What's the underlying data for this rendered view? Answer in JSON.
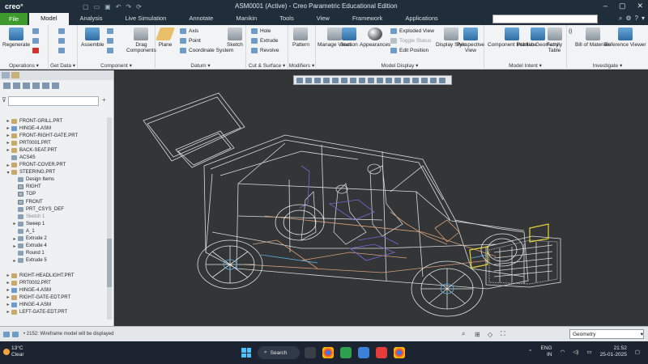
{
  "app": {
    "logo": "creo°",
    "window_title": "ASM0001 (Active) - Creo Parametric Educational Edition"
  },
  "menu_tabs": [
    "File",
    "Model",
    "Analysis",
    "Live Simulation",
    "Annotate",
    "Manikin",
    "Tools",
    "View",
    "Framework",
    "Applications"
  ],
  "active_tab": "Model",
  "ribbon": {
    "regenerate": "Regenerate",
    "assemble": "Assemble",
    "drag_components": "Drag Components",
    "plane": "Plane",
    "axis": "Axis",
    "point": "Point",
    "coord_sys": "Coordinate System",
    "sketch": "Sketch",
    "hole": "Hole",
    "extrude": "Extrude",
    "revolve": "Revolve",
    "pattern": "Pattern",
    "manage_views": "Manage Views",
    "section": "Section",
    "appearances": "Appearances",
    "exploded_view": "Exploded View",
    "toggle_status": "Toggle Status",
    "edit_position": "Edit Position",
    "display_style": "Display Style",
    "perspective_view": "Perspective View",
    "component_interface": "Component Interface",
    "publish_geometry": "Publish Geometry",
    "family_table": "Family Table",
    "bill_of_materials": "Bill of Materials",
    "reference_viewer": "Reference Viewer",
    "groups": {
      "operations": "Operations ▾",
      "get_data": "Get Data ▾",
      "component": "Component ▾",
      "datum": "Datum ▾",
      "cut_surface": "Cut & Surface ▾",
      "modifiers": "Modifiers ▾",
      "model_display": "Model Display ▾",
      "model_intent": "Model Intent ▾",
      "investigate": "Investigate ▾"
    }
  },
  "tree": [
    {
      "label": "FRONT-GRILL.PRT",
      "type": "part",
      "indent": 1,
      "exp": "▸"
    },
    {
      "label": "HINGE-4.ASM",
      "type": "asm",
      "indent": 1,
      "exp": "▸"
    },
    {
      "label": "FRONT-RIGHT-GATE.PRT",
      "type": "part",
      "indent": 1,
      "exp": "▸"
    },
    {
      "label": "PRT0001.PRT",
      "type": "part",
      "indent": 1,
      "exp": "▸"
    },
    {
      "label": "BACK-SEAT.PRT",
      "type": "part",
      "indent": 1,
      "exp": "▸"
    },
    {
      "label": "ACS4S",
      "type": "feat",
      "indent": 1,
      "exp": ""
    },
    {
      "label": "FRONT-COVER.PRT",
      "type": "part",
      "indent": 1,
      "exp": "▸"
    },
    {
      "label": "STEERING.PRT",
      "type": "part",
      "indent": 1,
      "exp": "▾"
    },
    {
      "label": "Design Items",
      "type": "feat",
      "indent": 2,
      "exp": ""
    },
    {
      "label": "RIGHT",
      "type": "plane",
      "indent": 2,
      "exp": ""
    },
    {
      "label": "TOP",
      "type": "plane",
      "indent": 2,
      "exp": ""
    },
    {
      "label": "FRONT",
      "type": "plane",
      "indent": 2,
      "exp": ""
    },
    {
      "label": "PRT_CSYS_DEF",
      "type": "feat",
      "indent": 2,
      "exp": ""
    },
    {
      "label": "Sketch 1",
      "type": "feat",
      "indent": 2,
      "exp": "",
      "dim": true
    },
    {
      "label": "Sweep 1",
      "type": "feat",
      "indent": 2,
      "exp": "▸"
    },
    {
      "label": "A_1",
      "type": "feat",
      "indent": 2,
      "exp": ""
    },
    {
      "label": "Extrude 2",
      "type": "feat",
      "indent": 2,
      "exp": "▸"
    },
    {
      "label": "Extrude 4",
      "type": "feat",
      "indent": 2,
      "exp": "▸"
    },
    {
      "label": "Round 1",
      "type": "feat",
      "indent": 2,
      "exp": ""
    },
    {
      "label": "Extrude 5",
      "type": "feat",
      "indent": 2,
      "exp": "▸"
    },
    {
      "label": "",
      "type": "none",
      "indent": 1,
      "exp": ""
    },
    {
      "label": "RIGHT-HEADLIGHT.PRT",
      "type": "part",
      "indent": 1,
      "exp": "▸"
    },
    {
      "label": "PRT0002.PRT",
      "type": "part",
      "indent": 1,
      "exp": "▸"
    },
    {
      "label": "HINGE-4.ASM",
      "type": "asm",
      "indent": 1,
      "exp": "▸"
    },
    {
      "label": "RIGHT-GATE-EDT.PRT",
      "type": "part",
      "indent": 1,
      "exp": "▸"
    },
    {
      "label": "HINGE-4.ASM",
      "type": "asm",
      "indent": 1,
      "exp": "▸"
    },
    {
      "label": "LEFT-GATE-EDT.PRT",
      "type": "part",
      "indent": 1,
      "exp": "▸"
    }
  ],
  "status": {
    "message": "• 2152: Wireframe model will be displayed",
    "selection_filter": "Geometry"
  },
  "taskbar": {
    "temperature": "13°C",
    "condition": "Clear",
    "search": "Search",
    "lang": "ENG",
    "region": "IN",
    "time": "21:52",
    "date": "25-01-2025"
  },
  "colors": {
    "file_tab": "#3e9a2c",
    "titlebar": "#1f2e3a",
    "viewport": "#333536",
    "wire_white": "#d9dde0",
    "wire_orange": "#d9a07a",
    "wire_blue": "#5fb0e8",
    "wire_yellow": "#e6d23c",
    "wire_purple": "#7a66d8"
  }
}
